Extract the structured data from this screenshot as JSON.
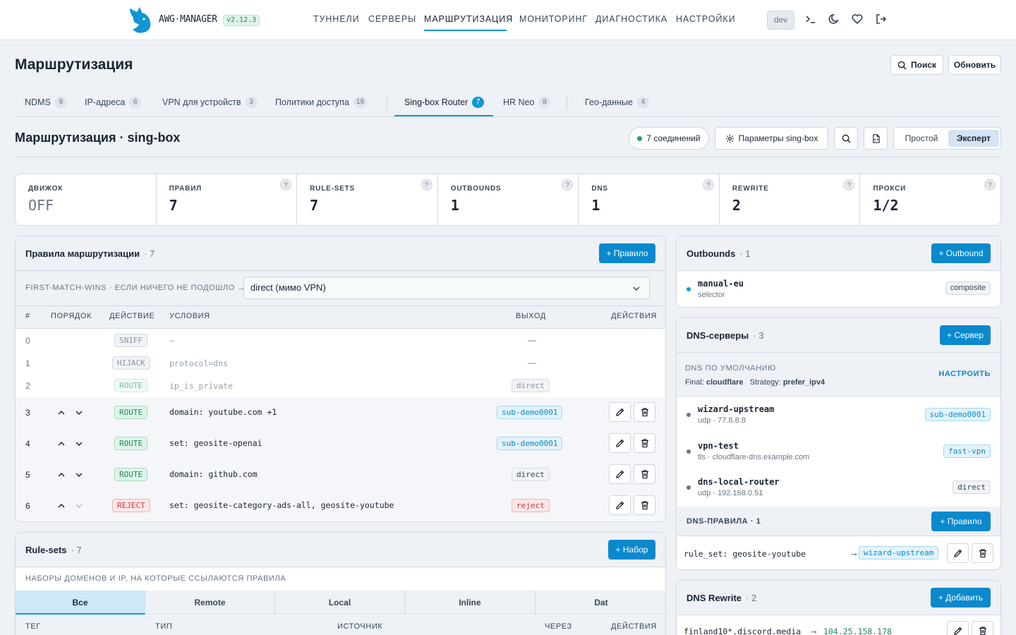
{
  "header": {
    "brand": "AWG·MANAGER",
    "version": "v2.12.3",
    "nav": [
      "ТУННЕЛИ",
      "СЕРВЕРЫ",
      "МАРШРУТИЗАЦИЯ",
      "МОНИТОРИНГ",
      "ДИАГНОСТИКА",
      "НАСТРОЙКИ"
    ],
    "active_nav": "МАРШРУТИЗАЦИЯ",
    "env": "dev",
    "icons": [
      "terminal-icon",
      "moon-icon",
      "heart-icon",
      "logout-icon"
    ]
  },
  "page": {
    "title": "Маршрутизация",
    "search_btn": "Поиск",
    "refresh_btn": "Обновить"
  },
  "tabs": [
    {
      "label": "NDMS",
      "count": "9"
    },
    {
      "label": "IP-адреса",
      "count": "6"
    },
    {
      "label": "VPN для устройств",
      "count": "3"
    },
    {
      "label": "Политики доступа",
      "count": "19"
    },
    {
      "label": "Sing-box Router",
      "count": "7",
      "active": true
    },
    {
      "label": "HR Neo",
      "count": "8"
    },
    {
      "label": "Гео-данные",
      "count": "4"
    }
  ],
  "section": {
    "title": "Маршрутизация · sing-box",
    "connections": "7 соединений",
    "params_btn": "Параметры sing-box",
    "mode_simple": "Простой",
    "mode_expert": "Эксперт"
  },
  "stats": [
    {
      "label": "ДВИЖОК",
      "value": "OFF"
    },
    {
      "label": "ПРАВИЛ",
      "value": "7"
    },
    {
      "label": "RULE-SETS",
      "value": "7"
    },
    {
      "label": "OUTBOUNDS",
      "value": "1"
    },
    {
      "label": "DNS",
      "value": "1"
    },
    {
      "label": "REWRITE",
      "value": "2"
    },
    {
      "label": "ПРОКСИ",
      "value": "1/2"
    }
  ],
  "rules_card": {
    "title": "Правила маршрутизации",
    "count": "· 7",
    "add_btn": "+ Правило",
    "hint": "FIRST-MATCH-WINS · ЕСЛИ НИЧЕГО НЕ ПОДОШЛО →",
    "fallback": "direct (мимо VPN)",
    "columns": [
      "#",
      "ПОРЯДОК",
      "ДЕЙСТВИЕ",
      "УСЛОВИЯ",
      "ВЫХОД",
      "ДЕЙСТВИЯ"
    ],
    "rows": [
      {
        "n": "0",
        "action": "SNIFF",
        "cond": "—",
        "out": "—"
      },
      {
        "n": "1",
        "action": "HIJACK",
        "cond": "protocol=dns",
        "out": "—"
      },
      {
        "n": "2",
        "action": "ROUTE",
        "cond": "ip_is_private",
        "out": "direct"
      },
      {
        "n": "3",
        "action": "ROUTE",
        "cond": "domain: youtube.com +1",
        "out": "sub-demo0001"
      },
      {
        "n": "4",
        "action": "ROUTE",
        "cond": "set: geosite-openai",
        "out": "sub-demo0001"
      },
      {
        "n": "5",
        "action": "ROUTE",
        "cond": "domain: github.com",
        "out": "direct"
      },
      {
        "n": "6",
        "action": "REJECT",
        "cond": "set: geosite-category-ads-all, geosite-youtube",
        "out": "reject"
      }
    ]
  },
  "rulesets_card": {
    "title": "Rule-sets",
    "count": "· 7",
    "add_btn": "+ Набор",
    "hint": "НАБОРЫ ДОМЕНОВ И IP, НА КОТОРЫЕ ССЫЛАЮТСЯ ПРАВИЛА",
    "filters": [
      "Все",
      "Remote",
      "Local",
      "Inline",
      "Dat"
    ],
    "columns": [
      "ТЕГ",
      "ТИП",
      "ИСТОЧНИК",
      "ЧЕРЕЗ",
      "ДЕЙСТВИЯ"
    ]
  },
  "outbounds_card": {
    "title": "Outbounds",
    "count": "· 1",
    "add_btn": "+ Outbound",
    "items": [
      {
        "name": "manual-eu",
        "sub": "selector",
        "tag": "composite"
      }
    ]
  },
  "dns_card": {
    "title": "DNS-серверы",
    "count": "· 3",
    "add_btn": "+ Сервер",
    "default_label": "DNS ПО УМОЛЧАНИЮ",
    "configure": "НАСТРОИТЬ",
    "final_label": "Final:",
    "final_value": "cloudflare",
    "strategy_label": "Strategy:",
    "strategy_value": "prefer_ipv4",
    "servers": [
      {
        "name": "wizard-upstream",
        "sub": "udp · 77.8.8.8",
        "tag": "sub-demo0001"
      },
      {
        "name": "vpn-test",
        "sub": "tls · cloudflare-dns.example.com",
        "tag": "fast-vpn"
      },
      {
        "name": "dns-local-router",
        "sub": "udp · 192.168.0.51",
        "tag": "direct"
      }
    ],
    "rules_label": "DNS-ПРАВИЛА · 1",
    "rules_add": "+ Правило",
    "rule": {
      "cond": "rule_set: geosite-youtube",
      "target": "wizard-upstream"
    }
  },
  "rewrite_card": {
    "title": "DNS Rewrite",
    "count": "· 2",
    "add_btn": "+ Добавить",
    "row": {
      "domain": "finland10*.discord.media",
      "target": "104.25.158.178"
    }
  }
}
